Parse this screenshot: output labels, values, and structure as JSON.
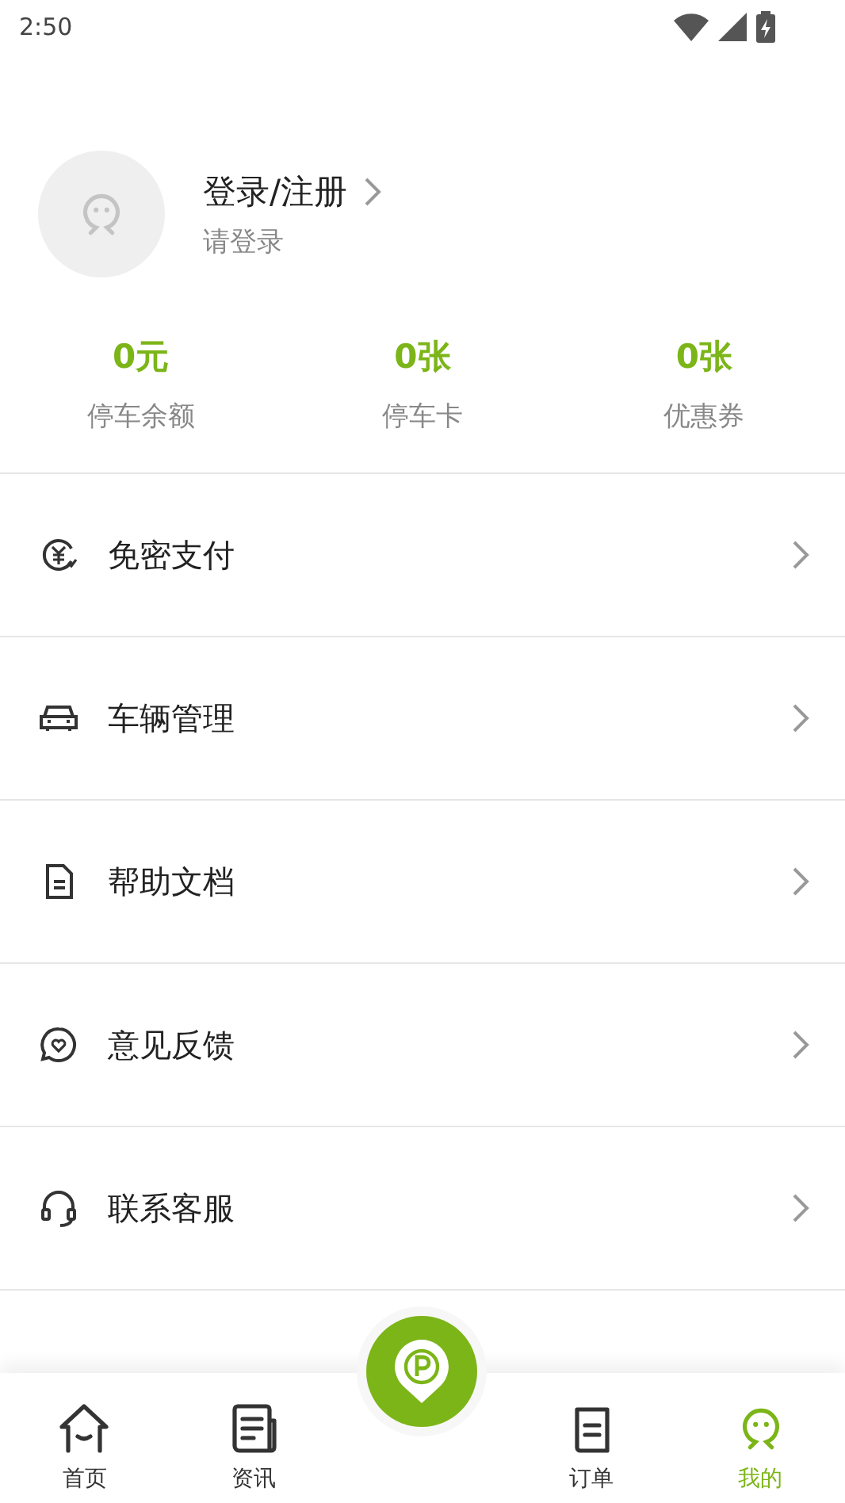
{
  "status_bar": {
    "time": "2:50"
  },
  "profile": {
    "title": "登录/注册",
    "subtitle": "请登录"
  },
  "stats": [
    {
      "value": "0元",
      "label": "停车余额"
    },
    {
      "value": "0张",
      "label": "停车卡"
    },
    {
      "value": "0张",
      "label": "优惠券"
    }
  ],
  "menu": [
    {
      "kind": "payment",
      "label": "免密支付"
    },
    {
      "kind": "car",
      "label": "车辆管理"
    },
    {
      "kind": "document",
      "label": "帮助文档"
    },
    {
      "kind": "feedback",
      "label": "意见反馈"
    },
    {
      "kind": "support",
      "label": "联系客服"
    }
  ],
  "tab_bar": [
    {
      "kind": "home",
      "label": "首页",
      "selected": false
    },
    {
      "kind": "news",
      "label": "资讯",
      "selected": false
    },
    {
      "kind": "center"
    },
    {
      "kind": "orders",
      "label": "订单",
      "selected": false
    },
    {
      "kind": "me",
      "label": "我的",
      "selected": true
    }
  ]
}
